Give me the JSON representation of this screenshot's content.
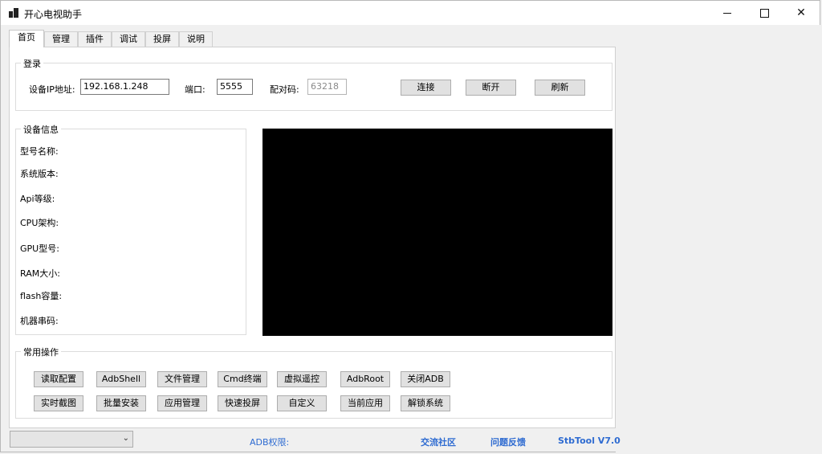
{
  "window": {
    "title": "开心电视助手"
  },
  "tabs": [
    "首页",
    "管理",
    "插件",
    "调试",
    "投屏",
    "说明"
  ],
  "login": {
    "legend": "登录",
    "ip_label": "设备IP地址:",
    "ip_value": "192.168.1.248",
    "port_label": "端口:",
    "port_value": "5555",
    "pair_label": "配对码:",
    "pair_placeholder": "63218",
    "buttons": [
      "连接",
      "断开",
      "刷新"
    ]
  },
  "device_info": {
    "legend": "设备信息",
    "fields": [
      "型号名称:",
      "系统版本:",
      "Api等级:",
      "CPU架构:",
      "GPU型号:",
      "RAM大小:",
      "flash容量:",
      "机器串码:"
    ]
  },
  "ops": {
    "legend": "常用操作",
    "row1": [
      "读取配置",
      "AdbShell",
      "文件管理",
      "Cmd终端",
      "虚拟遥控",
      "AdbRoot",
      "关闭ADB"
    ],
    "row2": [
      "实时截图",
      "批量安装",
      "应用管理",
      "快速投屏",
      "自定义",
      "当前应用",
      "解锁系统"
    ]
  },
  "status": {
    "combo_value": "",
    "adb_label": "ADB权限:",
    "community": "交流社区",
    "feedback": "问题反馈",
    "version": "StbTool V7.0"
  },
  "colors": {
    "link": "#2e6bd1",
    "preview": "#000000"
  }
}
